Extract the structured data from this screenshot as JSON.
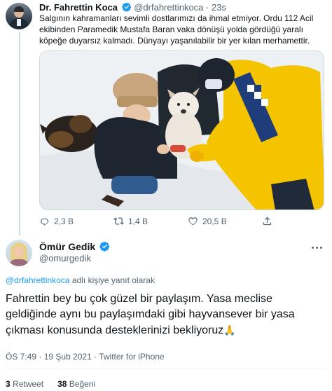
{
  "parent_tweet": {
    "author_name": "Dr. Fahrettin Koca",
    "author_handle": "@drfahrettinkoca",
    "separator": "·",
    "time": "23s",
    "text": "Salgının kahramanları sevimli dostlarımızı da ihmal etmiyor. Ordu 112 Acil ekibinden Paramedik Mustafa Baran vaka dönüşü yolda gördüğü yaralı köpeğe duyarsız kalmadı. Dünyayı yaşanılabilir bir yer kılan merhamettir.",
    "actions": {
      "replies": "2,3 B",
      "retweets": "1,4 B",
      "likes": "20,5 B"
    }
  },
  "tweet": {
    "author_name": "Ömür Gedik",
    "author_handle": "@omurgedik",
    "replying_mention": "@drfahrettinkoca",
    "replying_suffix": " adlı kişiye yanıt olarak",
    "text": "Fahrettin bey bu çok güzel bir paylaşım. Yasa meclise geldiğinde aynı bu paylaşımdaki gibi hayvansever bir yasa çıkması konusunda desteklerinizi bekliyoruz",
    "emoji": "🙏",
    "time": "ÖS 7:49",
    "date": "19 Şub 2021",
    "source": "Twitter for iPhone",
    "meta_separator": " · ",
    "retweet_count": "3",
    "retweet_label": "Retweet",
    "like_count": "38",
    "like_label": "Beğeni"
  },
  "colors": {
    "text": "#0f1419",
    "secondary": "#536471",
    "accent": "#1d9bf0",
    "divider": "#eff3f4"
  },
  "icons": [
    "verified-badge-icon",
    "reply-icon",
    "retweet-icon",
    "like-icon",
    "share-icon",
    "more-icon"
  ]
}
